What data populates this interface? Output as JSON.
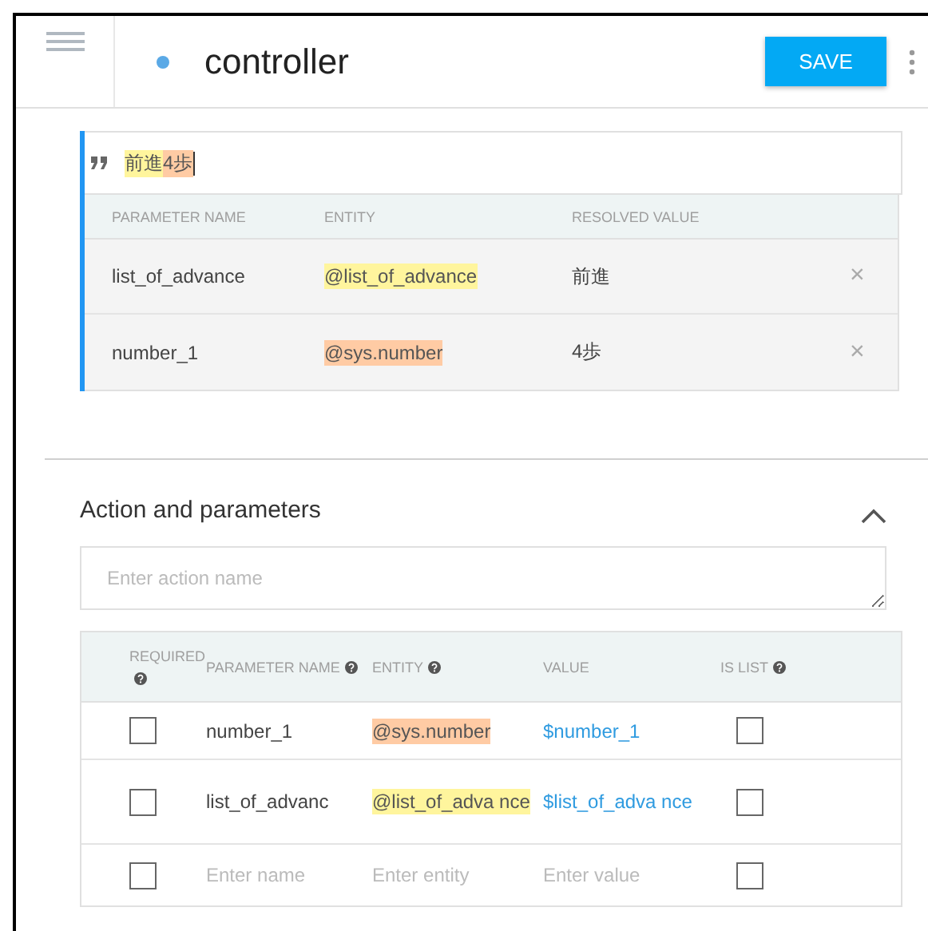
{
  "header": {
    "title": "controller",
    "save_button": "SAVE"
  },
  "query": {
    "segments": [
      {
        "text": "前進",
        "color": "#fff59d"
      },
      {
        "text": "4歩",
        "color": "#ffcba4"
      }
    ],
    "columns": [
      "PARAMETER NAME",
      "ENTITY",
      "RESOLVED VALUE"
    ],
    "rows": [
      {
        "parameter": "list_of_advance",
        "entity": "@list_of_advance",
        "color": "#fff59d",
        "value": "前進",
        "remove": "×"
      },
      {
        "parameter": "number_1",
        "entity": "@sys.number",
        "color": "#ffcba4",
        "value": "4歩",
        "remove": "×"
      }
    ]
  },
  "action_section": {
    "title": "Action and parameters",
    "expanded": true,
    "action_placeholder": "Enter action name",
    "columns": [
      {
        "label": "REQUIRED",
        "help": true
      },
      {
        "label": "PARAMETER NAME",
        "help": true
      },
      {
        "label": "ENTITY",
        "help": true
      },
      {
        "label": "VALUE",
        "help": false
      },
      {
        "label": "IS LIST",
        "help": true
      }
    ],
    "rows": [
      {
        "required": false,
        "parameter": "number_1",
        "entity": "@sys.number",
        "color": "#ffcba4",
        "value": "$number_1",
        "is_list": false
      },
      {
        "required": false,
        "parameter": "list_of_advanc",
        "entity": "@list_of_adva nce",
        "color": "#fff59d",
        "value": "$list_of_adva nce",
        "is_list": false
      }
    ],
    "new_row": {
      "required": false,
      "name_placeholder": "Enter name",
      "entity_placeholder": "Enter entity",
      "value_placeholder": "Enter value",
      "is_list": false
    }
  }
}
